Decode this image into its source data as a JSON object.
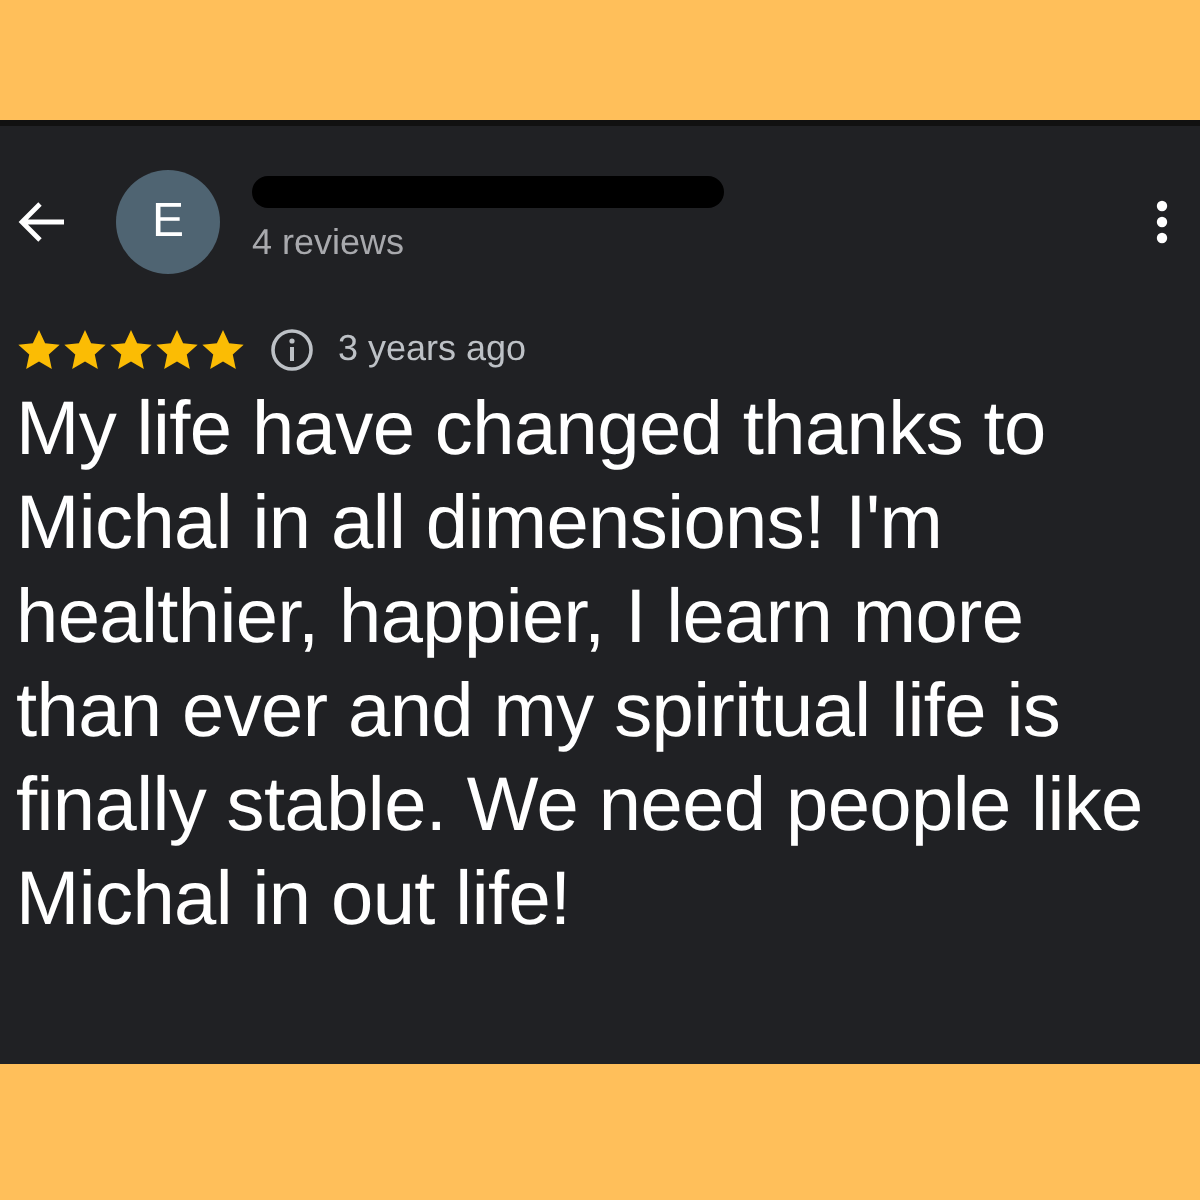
{
  "header": {
    "avatar_letter": "E",
    "reviews_count": "4 reviews",
    "name_redacted": true
  },
  "review": {
    "stars": 5,
    "time": "3 years ago",
    "text": "My life have changed thanks to Michal in all dimensions! I'm healthier, happier, I learn more than ever and my spiritual life is finally stable. We need people like Michal in out life!"
  }
}
